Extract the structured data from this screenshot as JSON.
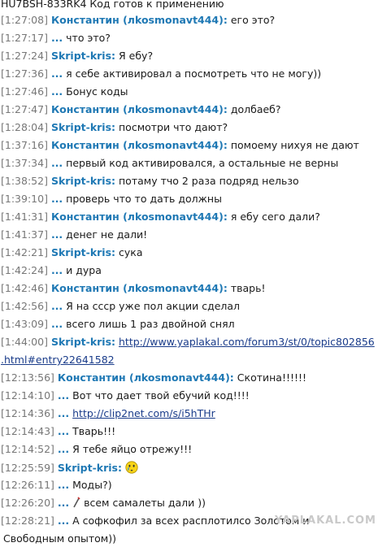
{
  "top_line": "HU7BSH-833RK4 Код готов к применению",
  "lines": [
    {
      "ts": "[1:27:08]",
      "nick": "Константин (лkosmonavt444):",
      "text": "его это?"
    },
    {
      "ts": "[1:27:17]",
      "nick": "...",
      "text": "что это?"
    },
    {
      "ts": "[1:27:24]",
      "nick": "Skript-kris:",
      "text": "Я ебу?"
    },
    {
      "ts": "[1:27:36]",
      "nick": "...",
      "text": "я себе активировал а посмотреть что не могу))"
    },
    {
      "ts": "[1:27:46]",
      "nick": "...",
      "text": "Бонус коды"
    },
    {
      "ts": "[1:27:47]",
      "nick": "Константин (лkosmonavt444):",
      "text": "долбаеб?"
    },
    {
      "ts": "[1:28:04]",
      "nick": "Skript-kris:",
      "text": "посмотри что дают?"
    },
    {
      "ts": "[1:37:16]",
      "nick": "Константин (лkosmonavt444):",
      "text": "помоему нихуя не дают"
    },
    {
      "ts": "[1:37:34]",
      "nick": "...",
      "text": "первый код активировался, а остальные не верны"
    },
    {
      "ts": "[1:38:52]",
      "nick": "Skript-kris:",
      "text": "потаму тчо 2 раза подряд нельзо"
    },
    {
      "ts": "[1:39:10]",
      "nick": "...",
      "text": "проверь что то дать должны"
    },
    {
      "ts": "[1:41:31]",
      "nick": "Константин (лkosmonavt444):",
      "text": "я ебу сего дали?"
    },
    {
      "ts": "[1:41:37]",
      "nick": "...",
      "text": "денег не дали!"
    },
    {
      "ts": "[1:42:21]",
      "nick": "Skript-kris:",
      "text": "сука"
    },
    {
      "ts": "[1:42:24]",
      "nick": "...",
      "text": "и дура"
    },
    {
      "ts": "[1:42:46]",
      "nick": "Константин (лkosmonavt444):",
      "text": "тварь!"
    },
    {
      "ts": "[1:42:56]",
      "nick": "...",
      "text": "Я на ссср уже пол акции сделал"
    },
    {
      "ts": "[1:43:09]",
      "nick": "...",
      "text": "всего лишь 1 раз двойной снял"
    },
    {
      "ts": "[1:44:00]",
      "nick": "Skript-kris:",
      "link": "http://www.yaplakal.com/forum3/st/0/topic802856"
    },
    {
      "continuation": ".html#entry22641582"
    },
    {
      "ts": "[12:13:56]",
      "nick": "Константин (лkosmonavt444):",
      "text": "Скотина!!!!!!"
    },
    {
      "ts": "[12:14:10]",
      "nick": "...",
      "text": "Вот что дает твой ебучий код!!!!"
    },
    {
      "ts": "[12:14:36]",
      "nick": "...",
      "link": "http://clip2net.com/s/i5hTHr"
    },
    {
      "ts": "[12:14:43]",
      "nick": "...",
      "text": "Тварь!!!"
    },
    {
      "ts": "[12:14:52]",
      "nick": "...",
      "text": "Я тебе яйцо отрежу!!!"
    },
    {
      "ts": "[12:25:59]",
      "nick": "Skript-kris:",
      "smiley": "crying-smiley-icon"
    },
    {
      "ts": "[12:26:11]",
      "nick": "...",
      "text": "Моды?)"
    },
    {
      "ts": "[12:26:20]",
      "nick": "...",
      "pencil": "pencil-icon",
      "text": "всем самалеты дали ))"
    },
    {
      "ts": "[12:28:21]",
      "nick": "...",
      "text": "А софкофил за всех расплотилсо Золотом и"
    },
    {
      "continuation": "Свободным опытом))"
    }
  ],
  "watermark": "YAPLAKAL.COM",
  "colors": {
    "nick": "#1e78b4",
    "timestamp": "#777777",
    "link": "#1a3c8a"
  }
}
